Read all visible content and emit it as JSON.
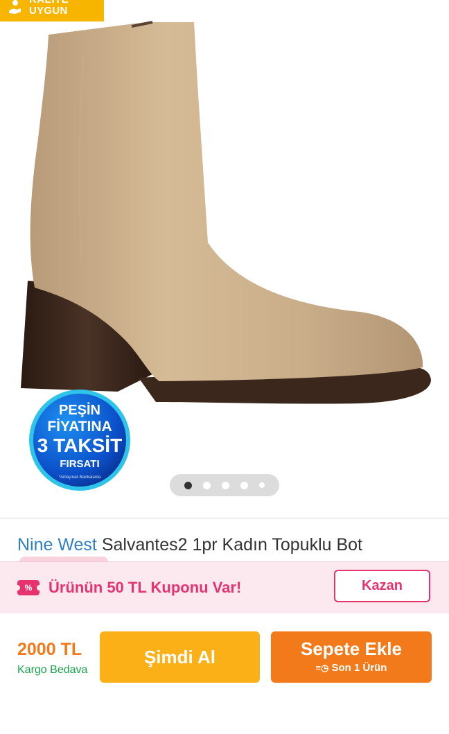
{
  "badge": {
    "line1": "KALİTE",
    "line2": "UYGUN",
    "icon": "hand-coin-icon"
  },
  "promo": {
    "line1": "PEŞİN",
    "line2": "FİYATINA",
    "line3": "3 TAKSİT",
    "line4": "FIRSATI",
    "footnote": "*Anlaşmalı Bankalarda"
  },
  "carousel": {
    "count": 5,
    "active": 0
  },
  "product": {
    "brand": "Nine West",
    "name": "Salvantes2 1pr Kadın Topuklu Bot"
  },
  "coupon": {
    "icon_text": "%",
    "text": "Ürünün 50 TL Kuponu Var!",
    "button": "Kazan"
  },
  "checkout": {
    "price": "2000 TL",
    "shipping": "Kargo Bedava",
    "buy_now": "Şimdi Al",
    "add_to_cart": "Sepete Ekle",
    "stock_note": "Son 1 Ürün"
  },
  "colors": {
    "brand_blue": "#2f7fc7",
    "orange": "#f27a1a",
    "yellow": "#fbb017",
    "pink": "#e6336e",
    "green": "#16a34a"
  }
}
